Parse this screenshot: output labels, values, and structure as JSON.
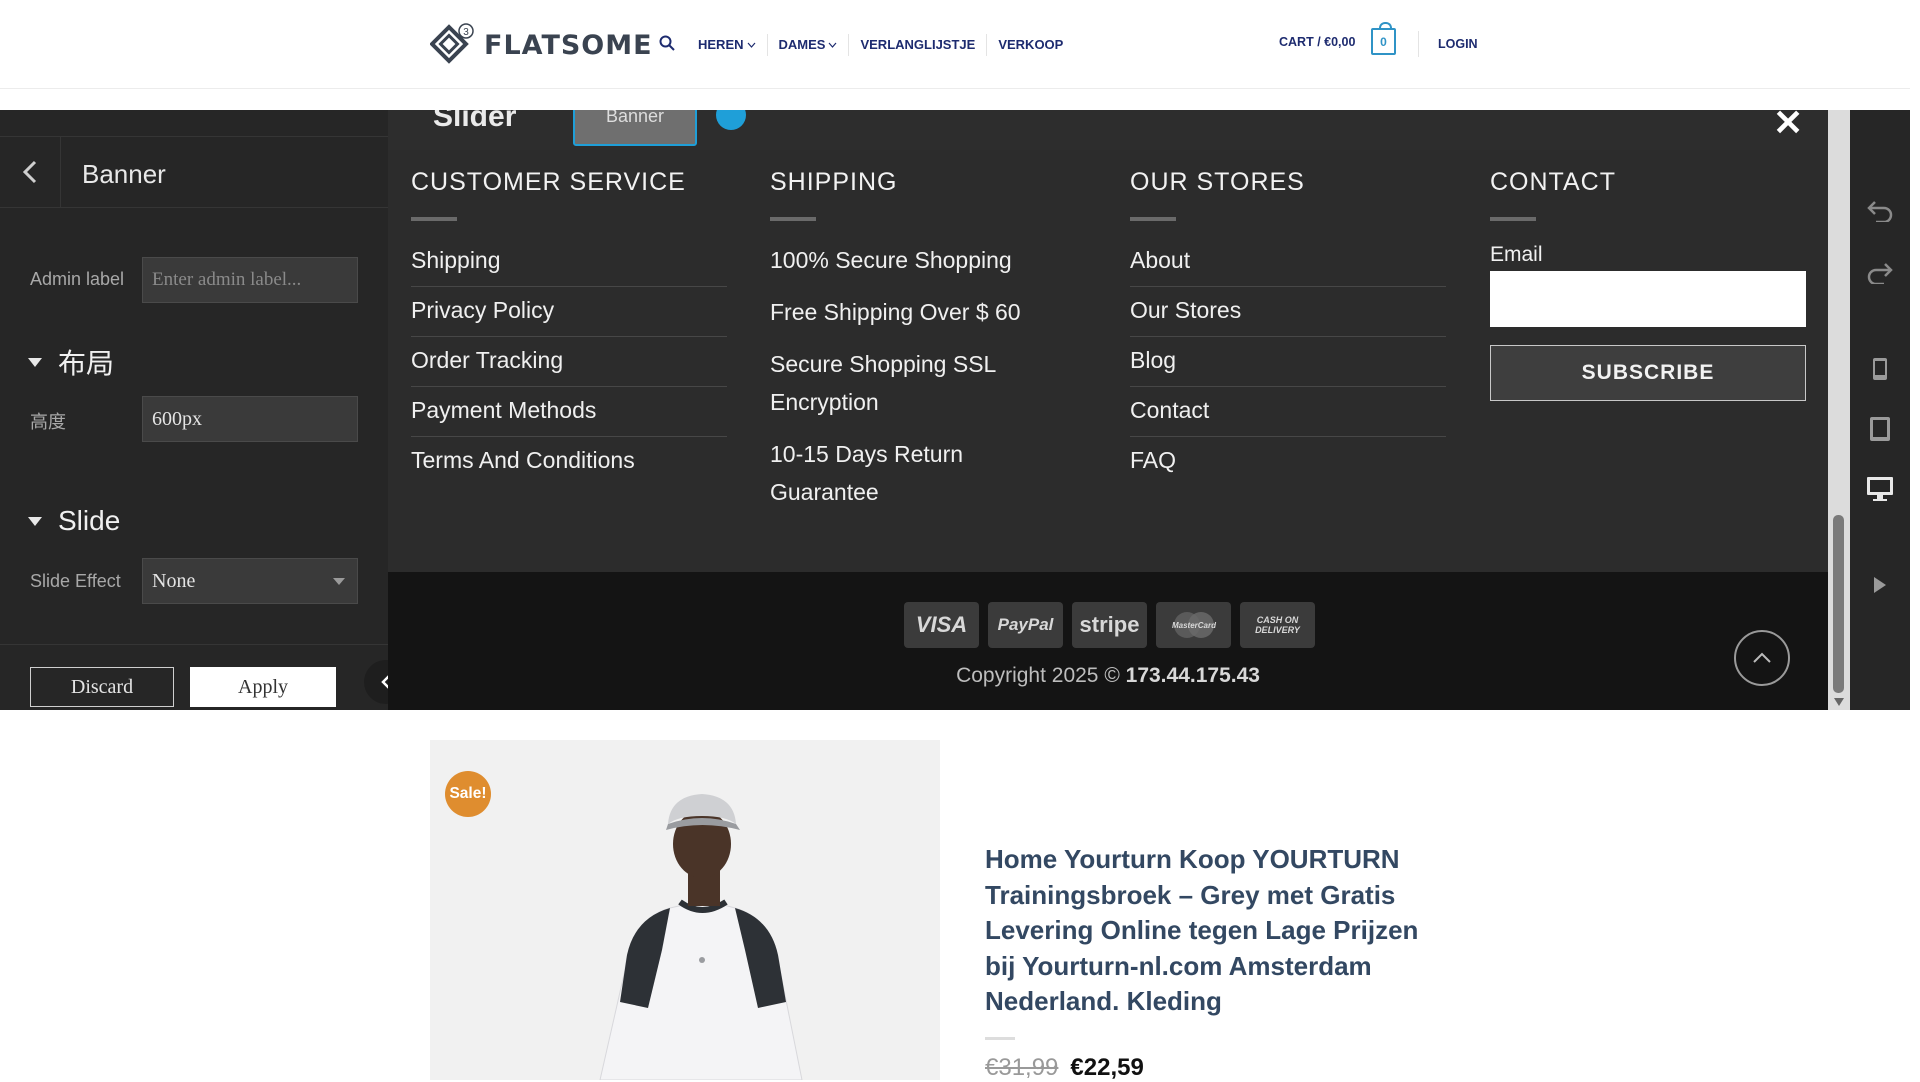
{
  "header": {
    "logo_text": "FLATSOME",
    "logo_badge": "3",
    "nav": [
      "HEREN",
      "DAMES",
      "VERLANGLIJSTJE",
      "VERKOOP"
    ],
    "cart_label": "CART / €0,00",
    "cart_count": "0",
    "login_label": "LOGIN"
  },
  "editor": {
    "panel_title": "Banner",
    "admin_label": "Admin label",
    "admin_placeholder": "Enter admin label...",
    "layout_section": "布局",
    "height_label": "高度",
    "height_value": "600px",
    "slide_section": "Slide",
    "slide_effect_label": "Slide Effect",
    "slide_effect_value": "None",
    "discard_label": "Discard",
    "apply_label": "Apply",
    "breadcrumb_slider": "Slider",
    "breadcrumb_banner": "Banner",
    "close_symbol": "✕"
  },
  "footer": {
    "columns": [
      {
        "title": "CUSTOMER SERVICE",
        "links": [
          "Shipping",
          "Privacy Policy",
          "Order Tracking",
          "Payment Methods",
          "Terms And Conditions"
        ]
      },
      {
        "title": "SHIPPING",
        "items": [
          " 100% Secure Shopping",
          " Free Shipping Over $ 60",
          " Secure Shopping SSL Encryption",
          " 10-15 Days Return Guarantee"
        ]
      },
      {
        "title": "OUR STORES",
        "links": [
          "About",
          "Our Stores",
          "Blog",
          "Contact",
          "FAQ"
        ]
      },
      {
        "title": "CONTACT",
        "email_label": "Email",
        "subscribe_label": "SUBSCRIBE"
      }
    ],
    "payments": [
      "VISA",
      "PayPal",
      "stripe",
      "MasterCard",
      "CASH ON DELIVERY"
    ],
    "copyright_prefix": "Copyright 2025 © ",
    "copyright_host": "173.44.175.43"
  },
  "product": {
    "sale_badge": "Sale!",
    "title": "Home Yourturn Koop YOURTURN Trainingsbroek – Grey met Gratis Levering Online tegen Lage Prijzen bij Yourturn-nl.com Amsterdam Nederland. Kleding",
    "old_price": "€31,99",
    "price": "€22,59"
  },
  "colors": {
    "nav_text": "#1d2b6f",
    "accent_blue": "#2f93c6",
    "sale_orange": "#df8d2f",
    "title_blue": "#334862"
  },
  "icons": [
    "search-icon",
    "chevron-down-icon",
    "back-arrow-icon",
    "undo-icon",
    "redo-icon",
    "mobile-icon",
    "tablet-icon",
    "desktop-icon",
    "play-icon",
    "close-icon",
    "chevron-up-icon"
  ]
}
